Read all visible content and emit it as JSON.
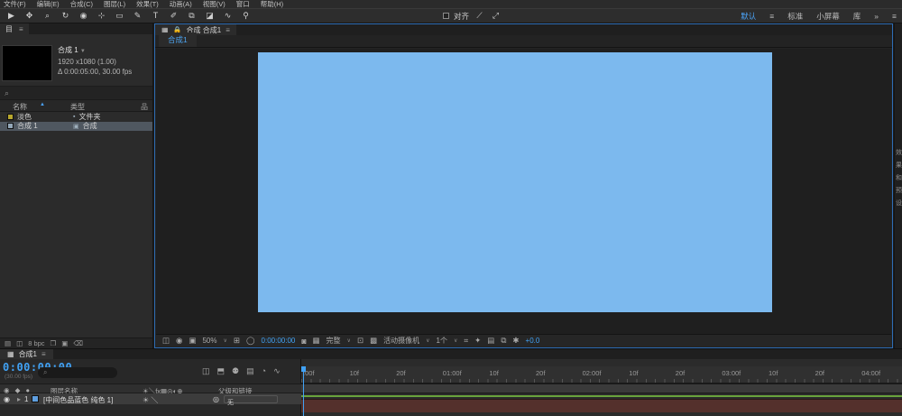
{
  "colors": {
    "accent": "#41a2f5",
    "canvas": "#7cb9ee",
    "selection_row": "#4f5760",
    "cache_green": "#69a33c",
    "layer_bar_maroon": "#54302c"
  },
  "menubar": {
    "items": [
      "文件(F)",
      "编辑(E)",
      "合成(C)",
      "图层(L)",
      "效果(T)",
      "动画(A)",
      "视图(V)",
      "窗口",
      "帮助(H)"
    ]
  },
  "toolbar": {
    "tools": [
      {
        "name": "selection-tool",
        "glyph": "▶"
      },
      {
        "name": "hand-tool",
        "glyph": "✥"
      },
      {
        "name": "zoom-tool",
        "glyph": "⌕"
      },
      {
        "name": "orbit-camera-tool",
        "glyph": "↻"
      },
      {
        "name": "camera-tool",
        "glyph": "◉"
      },
      {
        "name": "pan-behind-tool",
        "glyph": "⊹"
      },
      {
        "name": "shape-tool",
        "glyph": "▭"
      },
      {
        "name": "pen-tool",
        "glyph": "✎"
      },
      {
        "name": "type-tool",
        "glyph": "T"
      },
      {
        "name": "brush-tool",
        "glyph": "✐"
      },
      {
        "name": "clone-stamp-tool",
        "glyph": "⧉"
      },
      {
        "name": "eraser-tool",
        "glyph": "◪"
      },
      {
        "name": "roto-brush-tool",
        "glyph": "∿"
      },
      {
        "name": "puppet-tool",
        "glyph": "⚲"
      }
    ],
    "snap_label": "对齐",
    "extra_icons": [
      {
        "name": "snap-options-icon",
        "glyph": "⟋"
      },
      {
        "name": "maximize-icon",
        "glyph": "⤢"
      }
    ],
    "workspaces": [
      {
        "label": "默认",
        "active": true
      },
      {
        "label": "标准",
        "active": false
      },
      {
        "label": "小屏幕",
        "active": false
      },
      {
        "label": "库",
        "active": false
      }
    ],
    "overflow": "»",
    "panel_menu": "≡"
  },
  "project": {
    "tab_label": "目",
    "tab_menu": "≡",
    "comp_name": "合成 1",
    "comp_caret": "▼",
    "info_line1": "1920 x1080 (1.00)",
    "info_line2": "Δ 0:00:05:00, 30.00 fps",
    "search_icon": "⌕",
    "col_name": "名称",
    "col_sort": "▲",
    "col_type": "类型",
    "col_tree_icon": "品",
    "rows": [
      {
        "label_color": "#b8a72e",
        "name": "淡色",
        "type_icon": "▪",
        "type": "文件夹",
        "selected": false
      },
      {
        "label_color": "#93a7b8",
        "name": "合成 1",
        "type_icon": "▣",
        "type": "合成",
        "selected": true
      }
    ],
    "footer_bpc": "8 bpc",
    "footer_icons": [
      {
        "name": "interpret-footage-icon",
        "glyph": "▤"
      },
      {
        "name": "proxy-icon",
        "glyph": "◫"
      },
      {
        "name": "new-folder-icon",
        "glyph": "❐"
      },
      {
        "name": "new-comp-icon",
        "glyph": "▣"
      },
      {
        "name": "delete-icon",
        "glyph": "⌫"
      }
    ]
  },
  "comp": {
    "panel_icon": "▦",
    "lock_icon": "🔒",
    "panel_tab": "合成 合成1",
    "panel_menu": "≡",
    "viewer_tab": "合成1",
    "canvas_color": "#7cb9ee",
    "zoom": "50%",
    "timecode": "0:00:00:00",
    "resolution": "完整",
    "camera": "活动摄像机",
    "view_count": "1个",
    "exposure": "+0.0",
    "caret": "∨",
    "icons": [
      {
        "name": "always-preview-icon",
        "glyph": "◫"
      },
      {
        "name": "main-viewer-icon",
        "glyph": "◉"
      },
      {
        "name": "channel-settings-icon",
        "glyph": "▣"
      },
      {
        "name": "grid-guides-icon",
        "glyph": "⊞"
      },
      {
        "name": "mask-visibility-icon",
        "glyph": "◯"
      },
      {
        "name": "snapshot-icon",
        "glyph": "◙"
      },
      {
        "name": "show-snapshot-icon",
        "glyph": "▦"
      },
      {
        "name": "region-of-interest-icon",
        "glyph": "⊡"
      },
      {
        "name": "transparency-grid-icon",
        "glyph": "▩"
      },
      {
        "name": "pixel-aspect-icon",
        "glyph": "⌗"
      },
      {
        "name": "fast-preview-icon",
        "glyph": "✦"
      },
      {
        "name": "timeline-button-icon",
        "glyph": "▤"
      },
      {
        "name": "flowchart-button-icon",
        "glyph": "⧉"
      },
      {
        "name": "exposure-icon",
        "glyph": "✱"
      }
    ]
  },
  "rightdock": {
    "chars": [
      "效",
      "果",
      "和",
      "预",
      "设"
    ]
  },
  "timeline": {
    "tab_icon": "▦",
    "tab": "合成1",
    "panel_menu": "≡",
    "timecode": "0:00:00:00",
    "fps_note": "(30.00 fps)",
    "search_icon": "⌕",
    "cluster": [
      {
        "name": "comp-mini-flowchart-icon",
        "glyph": "◫"
      },
      {
        "name": "draft-3d-icon",
        "glyph": "⬒"
      },
      {
        "name": "shy-layers-icon",
        "glyph": "⚉"
      },
      {
        "name": "frame-blending-icon",
        "glyph": "▤"
      },
      {
        "name": "motion-blur-icon",
        "glyph": "◔"
      },
      {
        "name": "graph-editor-icon",
        "glyph": "∿"
      }
    ],
    "header": {
      "av_icons": "◉ ◆ ●",
      "layer_name": "图层名称",
      "switches": "☀＼fx▦◎◐⊕",
      "parent": "父级和链接"
    },
    "layer": {
      "eye": "◉",
      "expander": "▸",
      "index": "1",
      "swatch": "#5f9fe0",
      "name": "[中间色品蓝色 纯色 1]",
      "switches": "☀ ＼",
      "pickwhip": "◎",
      "parent_value": "无",
      "caret": "∨"
    },
    "ruler": [
      ":00f",
      "10f",
      "20f",
      "01:00f",
      "10f",
      "20f",
      "02:00f",
      "10f",
      "20f",
      "03:00f",
      "10f",
      "20f",
      "04:00f"
    ],
    "colors": {
      "green": "#69a33c",
      "maroon": "#54302c"
    }
  }
}
